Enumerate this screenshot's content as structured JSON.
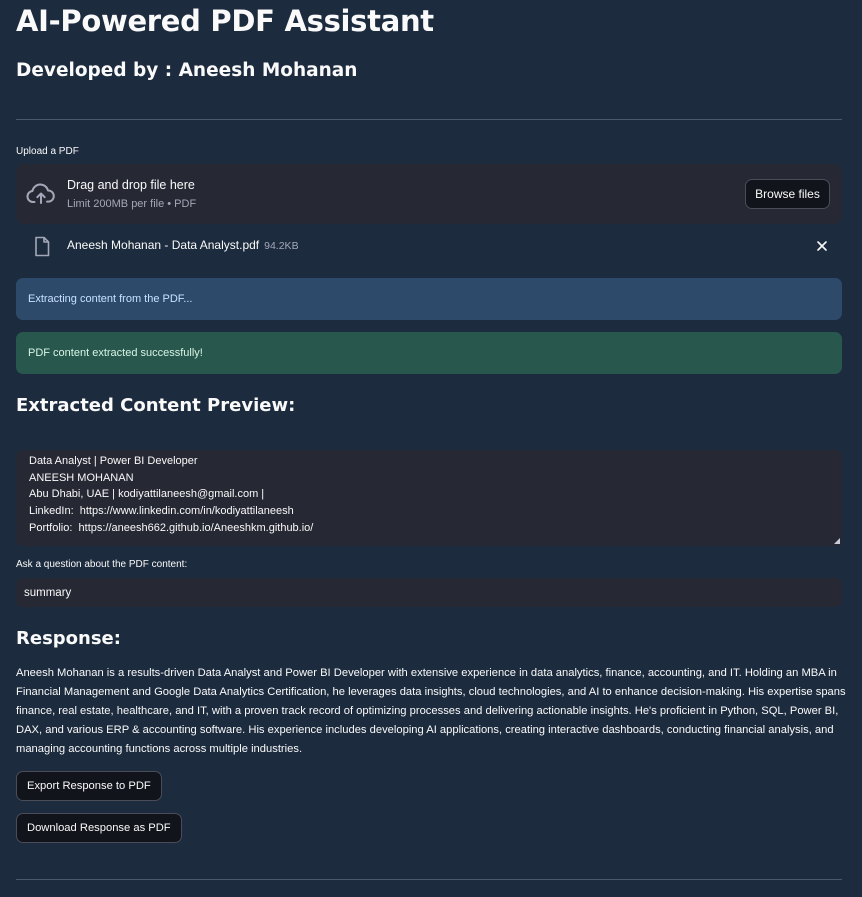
{
  "app": {
    "title": "AI-Powered PDF Assistant",
    "subtitle": "Developed by : Aneesh Mohanan"
  },
  "uploader": {
    "label": "Upload a PDF",
    "drop_title": "Drag and drop file here",
    "drop_limit": "Limit 200MB per file • PDF",
    "browse_label": "Browse files",
    "file": {
      "name": "Aneesh Mohanan - Data Analyst.pdf",
      "size": "94.2KB"
    }
  },
  "alerts": {
    "info": "Extracting content from the PDF...",
    "success": "PDF content extracted successfully!"
  },
  "preview": {
    "heading": "Extracted Content Preview:",
    "lines": [
      "Data Analyst | Power BI Developer",
      "ANEESH MOHANAN",
      "Abu Dhabi, UAE | kodiyattilaneesh@gmail.com |",
      "LinkedIn:  https://www.linkedin.com/in/kodiyattilaneesh",
      "Portfolio:  https://aneesh662.github.io/Aneeshkm.github.io/"
    ]
  },
  "question": {
    "label": "Ask a question about the PDF content:",
    "value": "summary"
  },
  "response": {
    "heading": "Response:",
    "text": "Aneesh Mohanan is a results-driven Data Analyst and Power BI Developer with extensive experience in data analytics, finance, accounting, and IT. Holding an MBA in Financial Management and Google Data Analytics Certification, he leverages data insights, cloud technologies, and AI to enhance decision-making. His expertise spans finance, real estate, healthcare, and IT, with a proven track record of optimizing processes and delivering actionable insights. He's proficient in Python, SQL, Power BI, DAX, and various ERP & accounting software. His experience includes developing AI applications, creating interactive dashboards, conducting financial analysis, and managing accounting functions across multiple industries."
  },
  "actions": {
    "export_label": "Export Response to PDF",
    "download_label": "Download Response as PDF"
  }
}
